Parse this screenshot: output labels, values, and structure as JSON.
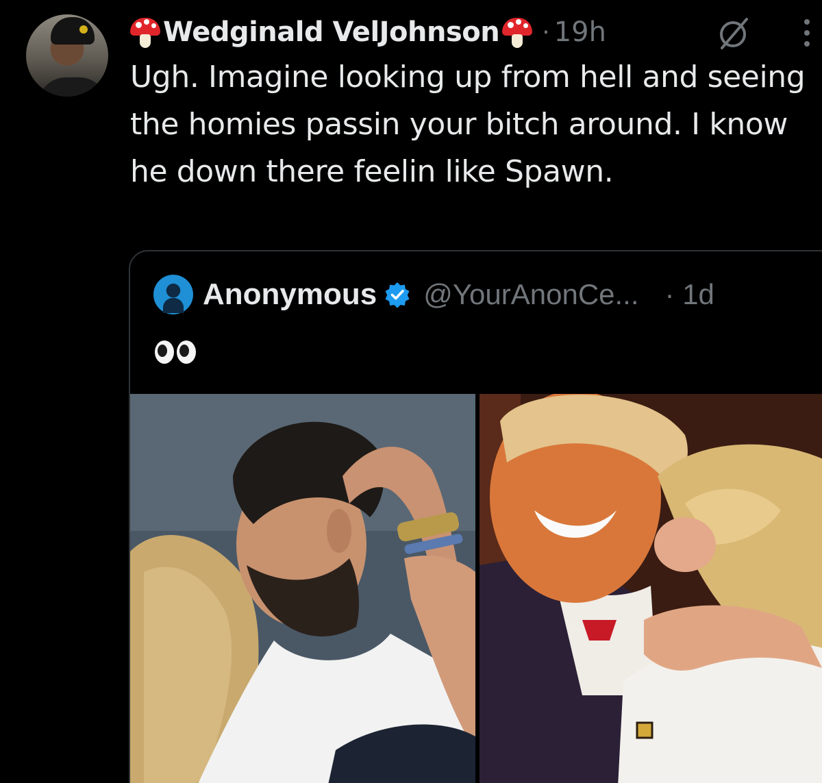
{
  "post": {
    "display_name": "Wedginald VelJohnson",
    "separator": "·",
    "time": "19h",
    "text": "Ugh. Imagine looking up from hell and seeing the homies passin your bitch around. I know he down there feelin like Spawn.",
    "name_emoji_icon": "mushroom-icon",
    "menu_icon": "more-vertical-icon",
    "grok_icon": "grok-slash-icon"
  },
  "quoted_post": {
    "display_name": "Anonymous",
    "handle": "@YourAnonCe...",
    "separator": "·",
    "time": "1d",
    "verified_icon": "verified-badge-icon",
    "verified_color": "#1d9bf0",
    "emoji": "👀",
    "emoji_icon": "eyes-emoji-icon",
    "media": [
      {
        "name": "left-photo",
        "description_icon": "photo-embrace-1"
      },
      {
        "name": "right-photo",
        "description_icon": "photo-embrace-2"
      }
    ]
  },
  "colors": {
    "background": "#000000",
    "text_primary": "#e7e9ea",
    "text_secondary": "#71767b",
    "border": "#2f3336"
  }
}
